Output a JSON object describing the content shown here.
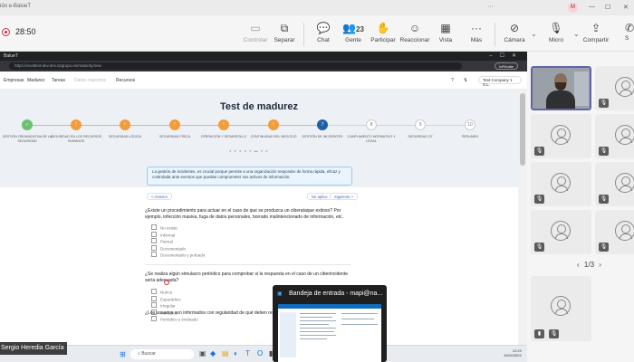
{
  "window": {
    "title": "ión e-BalueT",
    "avatar": "M"
  },
  "toolbar": {
    "timer": "28:50",
    "buttons": [
      {
        "label": "Controlar",
        "icon": "control-icon"
      },
      {
        "label": "Separar",
        "icon": "pop-out-icon"
      },
      {
        "label": "Chat",
        "icon": "chat-icon"
      },
      {
        "label": "Gente",
        "icon": "people-icon",
        "count": "23"
      },
      {
        "label": "Participar",
        "icon": "raise-hand-icon"
      },
      {
        "label": "Reaccionar",
        "icon": "react-icon"
      },
      {
        "label": "Vista",
        "icon": "view-icon"
      },
      {
        "label": "Más",
        "icon": "more-icon"
      },
      {
        "label": "Cámara",
        "icon": "camera-off-icon"
      },
      {
        "label": "Micro",
        "icon": "mic-off-icon"
      },
      {
        "label": "Compartir",
        "icon": "share-icon"
      },
      {
        "label": "S",
        "icon": "leave-icon"
      }
    ]
  },
  "browser": {
    "tab": "BalueT",
    "url": "https://evaltest-dev.dev.s2grupo.es/maturity/new",
    "profile_button": "InPrivate"
  },
  "app": {
    "nav": [
      "Empresas",
      "Madurez",
      "Tareas",
      "Datos maestros",
      "Recursos"
    ],
    "company": "Test Company 1 S.L.",
    "page_title": "Test de madurez",
    "steps": [
      {
        "n": "✓",
        "label": "Gestión organizativa de la seguridad",
        "state": "done"
      },
      {
        "n": "!",
        "label": "Seguridad en los recursos humanos",
        "state": "act"
      },
      {
        "n": "!",
        "label": "Seguridad lógica",
        "state": "act"
      },
      {
        "n": "!",
        "label": "Seguridad física",
        "state": "act"
      },
      {
        "n": "!",
        "label": "Operación y desarrollo",
        "state": "act"
      },
      {
        "n": "!",
        "label": "Continuidad del negocio",
        "state": "act"
      },
      {
        "n": "7",
        "label": "Gestión de incidentes",
        "state": "cur"
      },
      {
        "n": "8",
        "label": "Cumplimiento normativo y legal",
        "state": "todo"
      },
      {
        "n": "9",
        "label": "Seguridad OT",
        "state": "todo"
      },
      {
        "n": "10",
        "label": "Resumen",
        "state": "todo"
      }
    ],
    "info": "La gestión de incidentes, es crucial porque permite a una organización responder de forma rápida, eficaz y controlada ante eventos que puedan comprometer sus activos de información.",
    "btn_back": "< Anterior",
    "btn_na": "No aplica",
    "btn_next": "Siguiente >",
    "q1": "¿Existe un procedimiento para actuar en el caso de que se produzca un ciberataque exitoso? Por ejemplo, infección masiva, fuga de datos personales, borrado malintencionado de información, etc.",
    "q1_options": [
      "No existe",
      "Informal",
      "Parcial",
      "Documentado",
      "Documentado y probado"
    ],
    "q2": "¿Se realiza algún simulacro periódico para comprobar si la respuesta en el caso de un ciberincidente sería adecuada?",
    "q2_options": [
      "Nunca",
      "Esporádico",
      "Irregular",
      "Periódico",
      "Periódico y evaluado"
    ],
    "q3": "¿Los usuarios son informados con regularidad de qué deben reportar sospechosa?"
  },
  "taskbar": {
    "search": "Buscar",
    "time": "12:29",
    "date": "11/04/2024"
  },
  "presenter": "Sergio Heredia García",
  "popup": {
    "title": "Bandeja de entrada - mapi@na..."
  },
  "pager": "1/3"
}
